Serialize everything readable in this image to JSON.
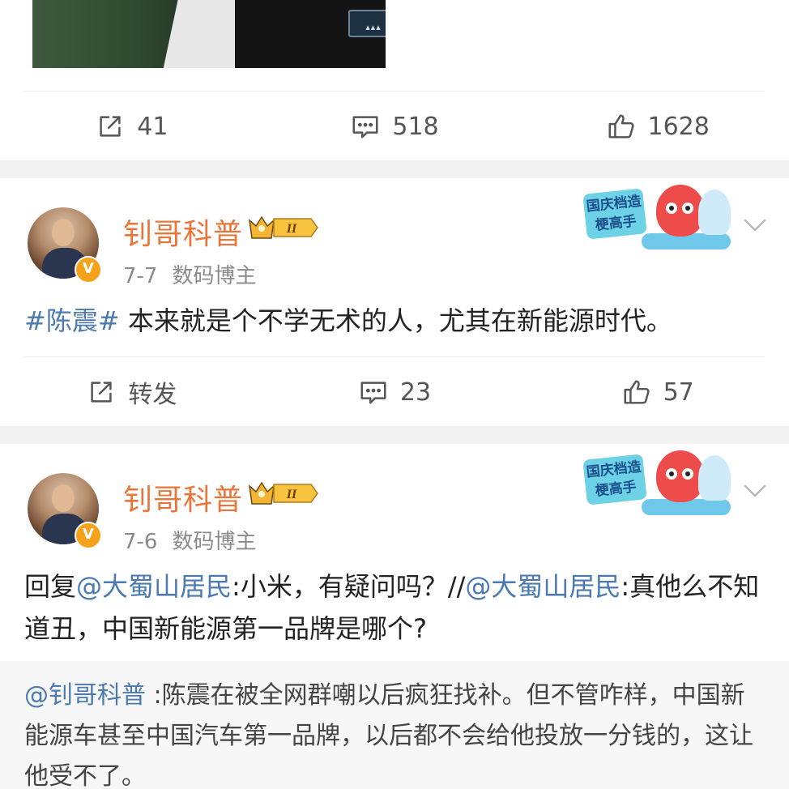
{
  "top_post": {
    "actions": {
      "repost_count": "41",
      "comment_count": "518",
      "like_count": "1628"
    }
  },
  "posts": [
    {
      "username": "钊哥科普",
      "vip_level": "II",
      "date": "7-7",
      "category": "数码博主",
      "event_badge_text": "国庆档造梗高手",
      "topic": "#陈震#",
      "text": " 本来就是个不学无术的人，尤其在新能源时代。",
      "actions": {
        "repost_label": "转发",
        "comment_count": "23",
        "like_count": "57"
      }
    },
    {
      "username": "钊哥科普",
      "vip_level": "II",
      "date": "7-6",
      "category": "数码博主",
      "event_badge_text": "国庆档造梗高手",
      "reply_prefix": "回复",
      "mention_1": "@大蜀山居民",
      "reply_text_1": ":小米，有疑问吗？//",
      "mention_2": "@大蜀山居民",
      "reply_text_2": ":真他么不知道丑，中国新能源第一品牌是哪个?",
      "quote": {
        "mention": "@钊哥科普",
        "text": " :陈震在被全网群嘲以后疯狂找补。但不管咋样，中国新能源车甚至中国汽车第一品牌，以后都不会给他投放一分钱的，这让他受不了。"
      }
    }
  ],
  "colors": {
    "username": "#e8753a",
    "link": "#4a7ab0",
    "meta": "#8a8a8a",
    "separator": "#f2f2f2"
  }
}
